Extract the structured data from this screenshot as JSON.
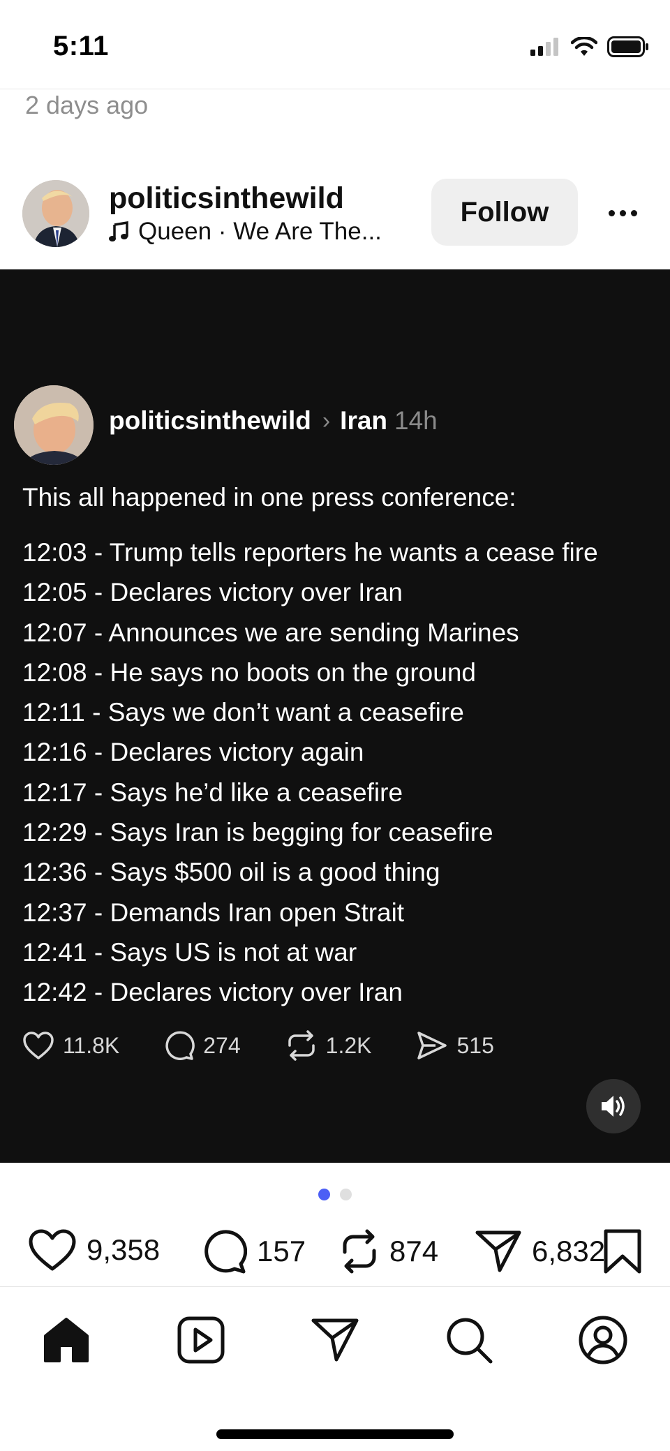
{
  "status_bar": {
    "time": "5:11"
  },
  "post": {
    "timestamp": "2 days ago",
    "username": "politicsinthewild",
    "audio": "Queen · We Are The...",
    "follow_label": "Follow"
  },
  "media": {
    "username": "politicsinthewild",
    "topic": "Iran",
    "age": "14h",
    "intro": "This all happened in one press conference:",
    "lines": [
      "12:03 - Trump tells reporters he wants a cease fire",
      "12:05 - Declares victory over Iran",
      "12:07 - Announces we are sending Marines",
      "12:08 - He says no boots on the ground",
      "12:11 - Says we don’t want a ceasefire",
      "12:16 - Declares victory again",
      "12:17 - Says he’d like a ceasefire",
      "12:29 - Says Iran is begging for ceasefire",
      "12:36 - Says $500 oil is a good thing",
      "12:37 - Demands Iran open Strait",
      "12:41 - Says US is not at war",
      "12:42 - Declares victory over Iran"
    ],
    "stats": {
      "likes": "11.8K",
      "replies": "274",
      "reposts": "1.2K",
      "shares": "515"
    }
  },
  "carousel": {
    "pages": 2,
    "current": 1
  },
  "actions": {
    "likes": "9,358",
    "comments": "157",
    "reposts": "874",
    "shares": "6,832"
  },
  "colors": {
    "accent": "#4c5ff5",
    "media_bg": "#101010",
    "button_bg": "#efefef"
  },
  "nav": [
    "home-icon",
    "reels-icon",
    "direct-icon",
    "search-icon",
    "profile-icon"
  ]
}
